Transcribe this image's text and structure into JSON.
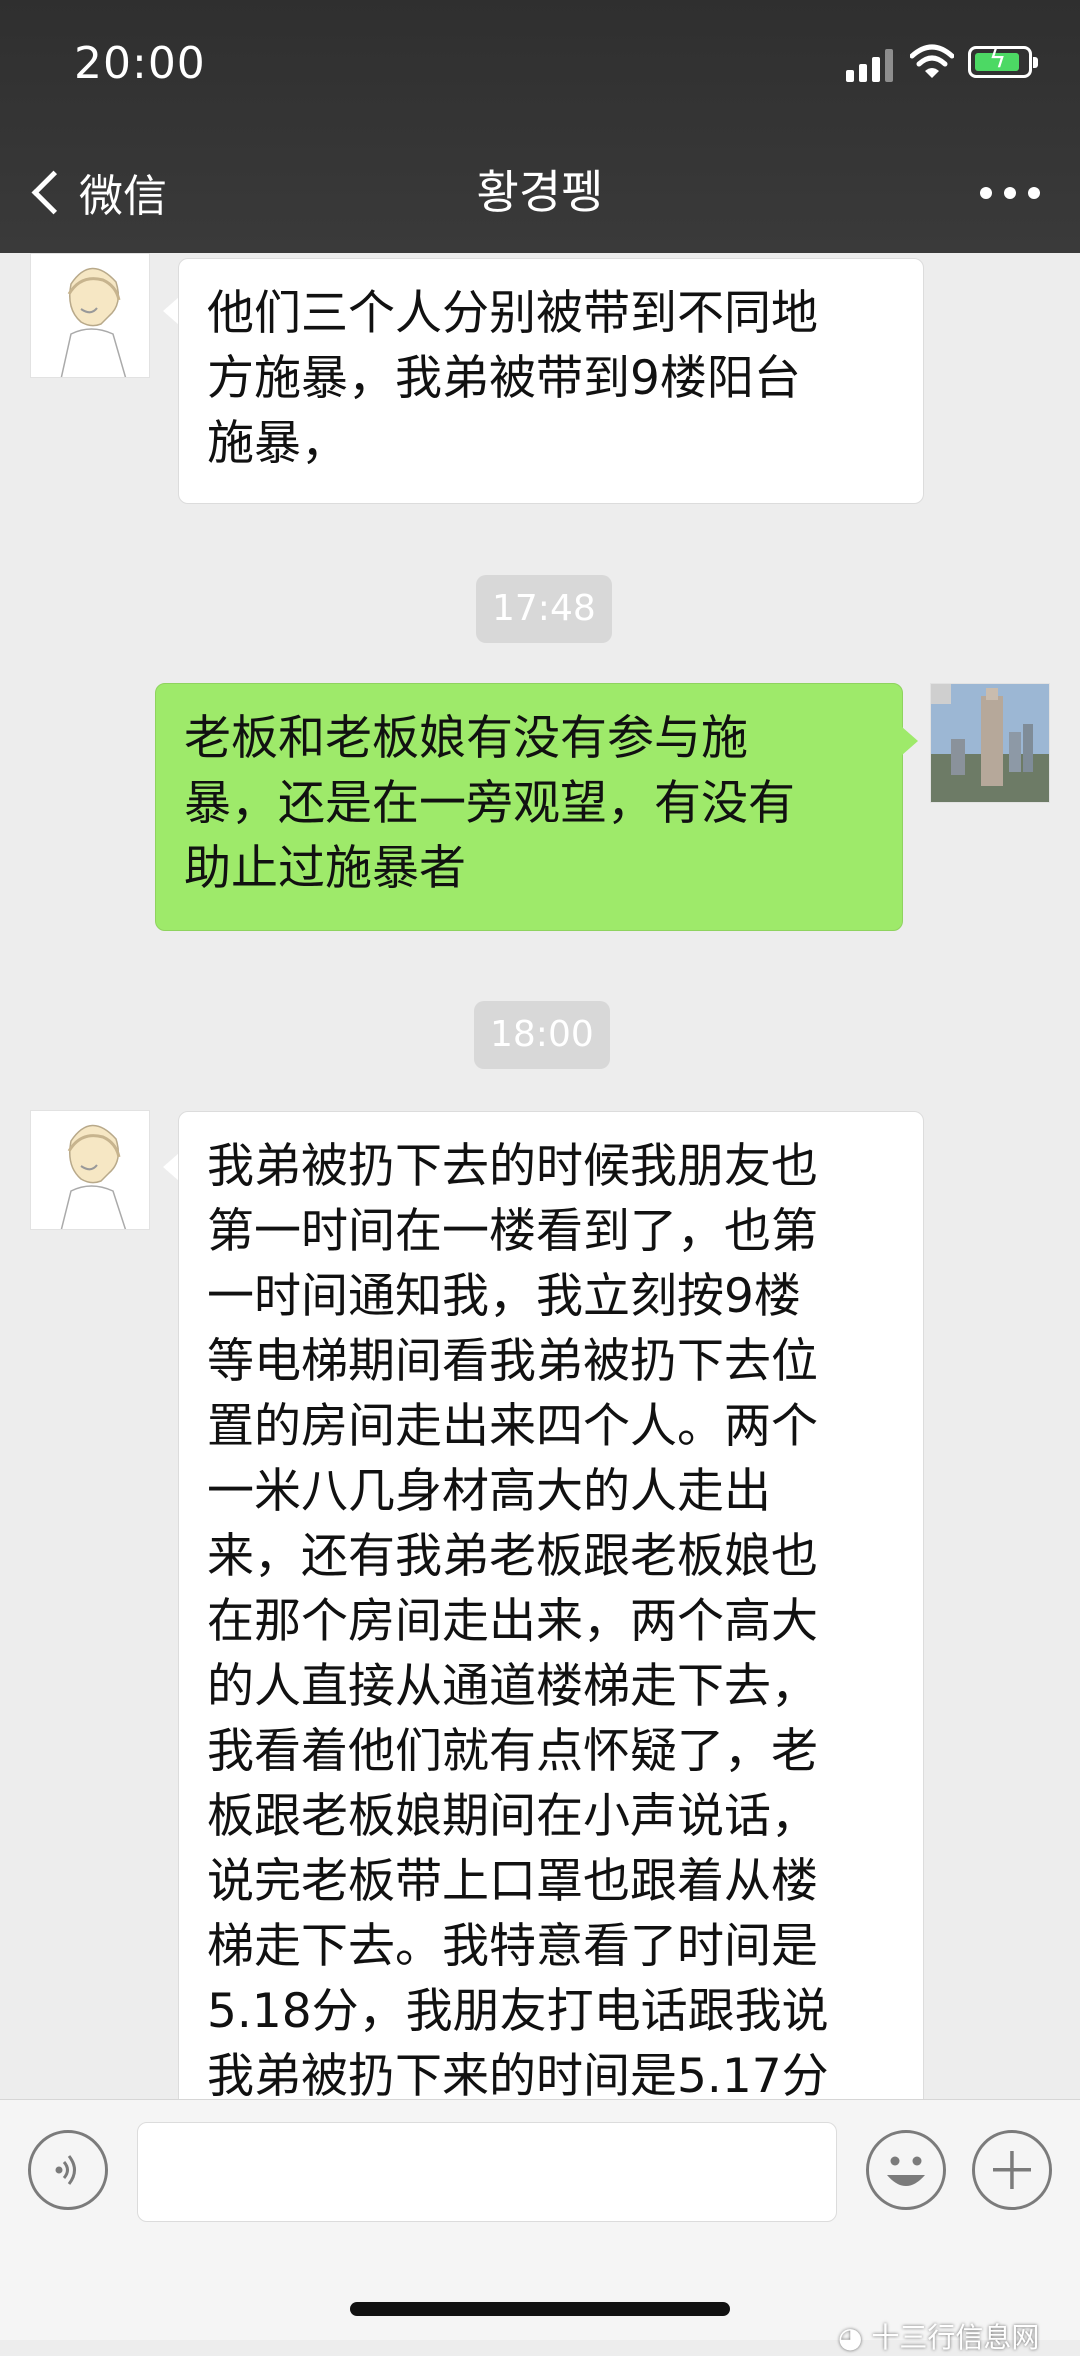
{
  "status_bar": {
    "time": "20:00"
  },
  "nav": {
    "back_label": "微信",
    "title": "황경펭"
  },
  "messages": [
    {
      "side": "left",
      "lines": [
        "他们三个人分别被带到不同地",
        "方施暴，我弟被带到9楼阳台",
        "施暴，"
      ]
    },
    {
      "type": "time",
      "text": "17:48"
    },
    {
      "side": "right",
      "lines": [
        "老板和老板娘有没有参与施",
        "暴，还是在一旁观望，有没有",
        "助止过施暴者"
      ]
    },
    {
      "type": "time",
      "text": "18:00"
    },
    {
      "side": "left",
      "lines": [
        "我弟被扔下去的时候我朋友也",
        "第一时间在一楼看到了，也第",
        "一时间通知我，我立刻按9楼",
        "等电梯期间看我弟被扔下去位",
        "置的房间走出来四个人。两个",
        "一米八几身材高大的人走出",
        "来，还有我弟老板跟老板娘也",
        "在那个房间走出来，两个高大",
        "的人直接从通道楼梯走下去，",
        "我看着他们就有点怀疑了，老",
        "板跟老板娘期间在小声说话，",
        "说完老板带上口罩也跟着从楼",
        "梯走下去。我特意看了时间是",
        "5.18分，我朋友打电话跟我说",
        "我弟被扔下来的时间是5.17分"
      ]
    }
  ],
  "icons": {
    "back": "chevron-left-icon",
    "more": "more-dots-icon",
    "voice": "voice-icon",
    "emoji": "emoji-icon",
    "add": "plus-icon"
  },
  "watermark": "十三行信息网",
  "colors": {
    "sent_bubble": "#9eea6a",
    "received_bubble": "#ffffff",
    "background": "#ededed",
    "header": "#333333"
  }
}
